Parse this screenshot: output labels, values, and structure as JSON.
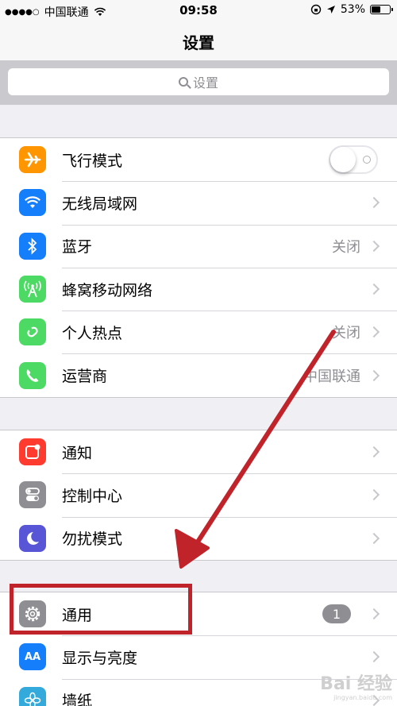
{
  "status": {
    "signal": "●●●●○",
    "carrier": "中国联通",
    "time": "09:58",
    "battery": "53%",
    "battery_level": 0.53
  },
  "nav": {
    "title": "设置"
  },
  "search": {
    "placeholder": "设置"
  },
  "groups": [
    {
      "rows": [
        {
          "label": "飞行模式",
          "icon": "airplane-icon",
          "color": "#ff9500",
          "control": "toggle",
          "toggle_on": false
        },
        {
          "label": "无线局域网",
          "icon": "wifi-icon",
          "color": "#147efb"
        },
        {
          "label": "蓝牙",
          "icon": "bluetooth-icon",
          "color": "#147efb",
          "value": "关闭"
        },
        {
          "label": "蜂窝移动网络",
          "icon": "cellular-icon",
          "color": "#4cd964"
        },
        {
          "label": "个人热点",
          "icon": "hotspot-icon",
          "color": "#4cd964",
          "value": "关闭"
        },
        {
          "label": "运营商",
          "icon": "phone-icon",
          "color": "#4cd964",
          "value": "中国联通"
        }
      ]
    },
    {
      "rows": [
        {
          "label": "通知",
          "icon": "notifications-icon",
          "color": "#ff3b30"
        },
        {
          "label": "控制中心",
          "icon": "control-center-icon",
          "color": "#8e8e93"
        },
        {
          "label": "勿扰模式",
          "icon": "moon-icon",
          "color": "#5856d6"
        }
      ]
    },
    {
      "rows": [
        {
          "label": "通用",
          "icon": "gear-icon",
          "color": "#8e8e93",
          "badge": "1"
        },
        {
          "label": "显示与亮度",
          "icon": "display-icon",
          "color": "#147efb",
          "icon_text": "AA"
        },
        {
          "label": "墙纸",
          "icon": "wallpaper-icon",
          "color": "#34aadc"
        }
      ]
    }
  ],
  "watermark": {
    "main": "Bai 经验",
    "sub": "jingyan.baidu.com"
  },
  "annotation_color": "#c0232a"
}
